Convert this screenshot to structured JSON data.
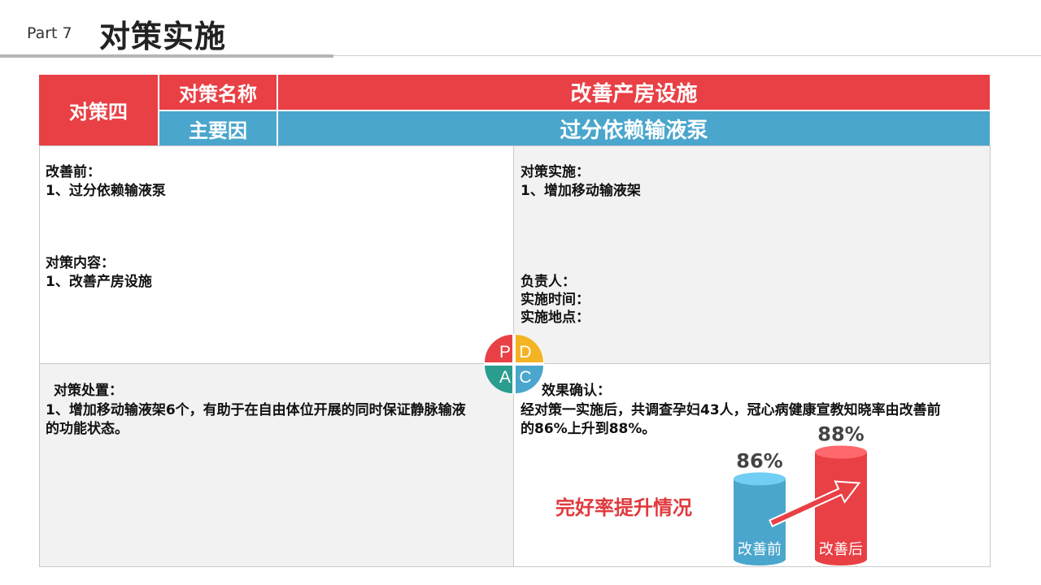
{
  "header": {
    "part": "Part 7",
    "title": "对策实施"
  },
  "table": {
    "measure": "对策四",
    "name_label": "对策名称",
    "name_value": "改善产房设施",
    "cause_label": "主要因",
    "cause_value": "过分依赖输液泵"
  },
  "left_top": {
    "before_label": "改善前：",
    "before_item": "1、过分依赖输液泵",
    "content_label": "对策内容：",
    "content_item": "1、改善产房设施"
  },
  "right_top": {
    "impl_label": "对策实施：",
    "impl_item": "1、增加移动输液架",
    "owner_label": "负责人：",
    "time_label": "实施时间：",
    "place_label": "实施地点："
  },
  "left_bottom": {
    "handle_label": "对策处置：",
    "handle_line1": "1、增加移动输液架6个，有助于在自由体位开展的同时保证静脉输液",
    "handle_line2": "的功能状态。"
  },
  "right_bottom": {
    "effect_label": "效果确认：",
    "effect_line1": "经对策一实施后，共调查孕妇43人，冠心病健康宣教知晓率由改善前",
    "effect_line2": "的86%上升到88%。",
    "chart_caption": "完好率提升情况"
  },
  "pdca": {
    "p": "P",
    "d": "D",
    "a": "A",
    "c": "C",
    "colors": {
      "p": "#e84045",
      "d": "#f4b323",
      "a": "#2a9d8f",
      "c": "#4aa6cc"
    }
  },
  "chart_data": {
    "type": "bar",
    "categories": [
      "改善前",
      "改善后"
    ],
    "values": [
      86,
      88
    ],
    "value_labels": [
      "86%",
      "88%"
    ],
    "colors": [
      "#4aa6cc",
      "#e84045"
    ],
    "title": "完好率提升情况"
  }
}
